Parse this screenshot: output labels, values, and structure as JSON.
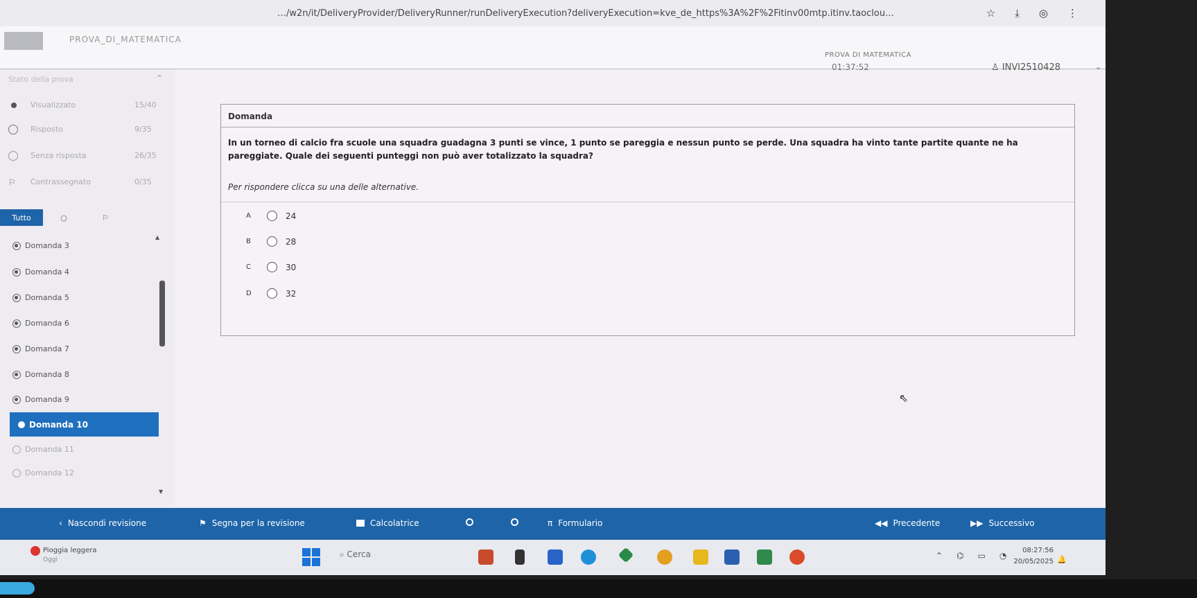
{
  "browser": {
    "url": "…/w2n/it/DeliveryProvider/DeliveryRunner/runDeliveryExecution?deliveryExecution=kve_de_https%3A%2F%2Fitinv00mtp.itinv.taoclou…"
  },
  "header": {
    "test_title": "PROVA_DI_MATEMATICA",
    "test_name": "PROVA DI MATEMATICA",
    "timer": "01:37:52",
    "user": "INVI2510428"
  },
  "sidebar": {
    "section_title": "Stato della prova",
    "stats": [
      {
        "label": "Visualizzato",
        "count": "15/40"
      },
      {
        "label": "Risposto",
        "count": "9/35"
      },
      {
        "label": "Senza risposta",
        "count": "26/35"
      },
      {
        "label": "Contrassegnato",
        "count": "0/35"
      }
    ],
    "filter_all": "Tutto",
    "questions": [
      {
        "label": "Domanda 3",
        "state": "answered"
      },
      {
        "label": "Domanda 4",
        "state": "answered"
      },
      {
        "label": "Domanda 5",
        "state": "answered"
      },
      {
        "label": "Domanda 6",
        "state": "answered"
      },
      {
        "label": "Domanda 7",
        "state": "answered"
      },
      {
        "label": "Domanda 8",
        "state": "answered"
      },
      {
        "label": "Domanda 9",
        "state": "answered"
      },
      {
        "label": "Domanda 10",
        "state": "current"
      },
      {
        "label": "Domanda 11",
        "state": "unanswered"
      },
      {
        "label": "Domanda 12",
        "state": "unanswered"
      }
    ]
  },
  "question": {
    "header": "Domanda",
    "text": "In un torneo di calcio fra scuole una squadra guadagna 3 punti se vince, 1 punto se pareggia e nessun punto se perde. Una squadra ha vinto tante partite quante ne ha pareggiate. Quale dei seguenti punteggi non può aver totalizzato la squadra?",
    "instruction": "Per rispondere clicca su una delle alternative.",
    "choices": [
      {
        "letter": "A",
        "value": "24"
      },
      {
        "letter": "B",
        "value": "28"
      },
      {
        "letter": "C",
        "value": "30"
      },
      {
        "letter": "D",
        "value": "32"
      }
    ]
  },
  "actions": {
    "hide_review": "Nascondi revisione",
    "mark_review": "Segna per la revisione",
    "calculator": "Calcolatrice",
    "formulary": "Formulario",
    "previous": "Precedente",
    "next": "Successivo"
  },
  "taskbar": {
    "weather": "Pioggia leggera",
    "weather_sub": "Oggi",
    "search": "Cerca",
    "time": "08:27:56",
    "date": "20/05/2025"
  },
  "colors": {
    "accent": "#1e64a8",
    "active_item": "#1f6fbf"
  }
}
